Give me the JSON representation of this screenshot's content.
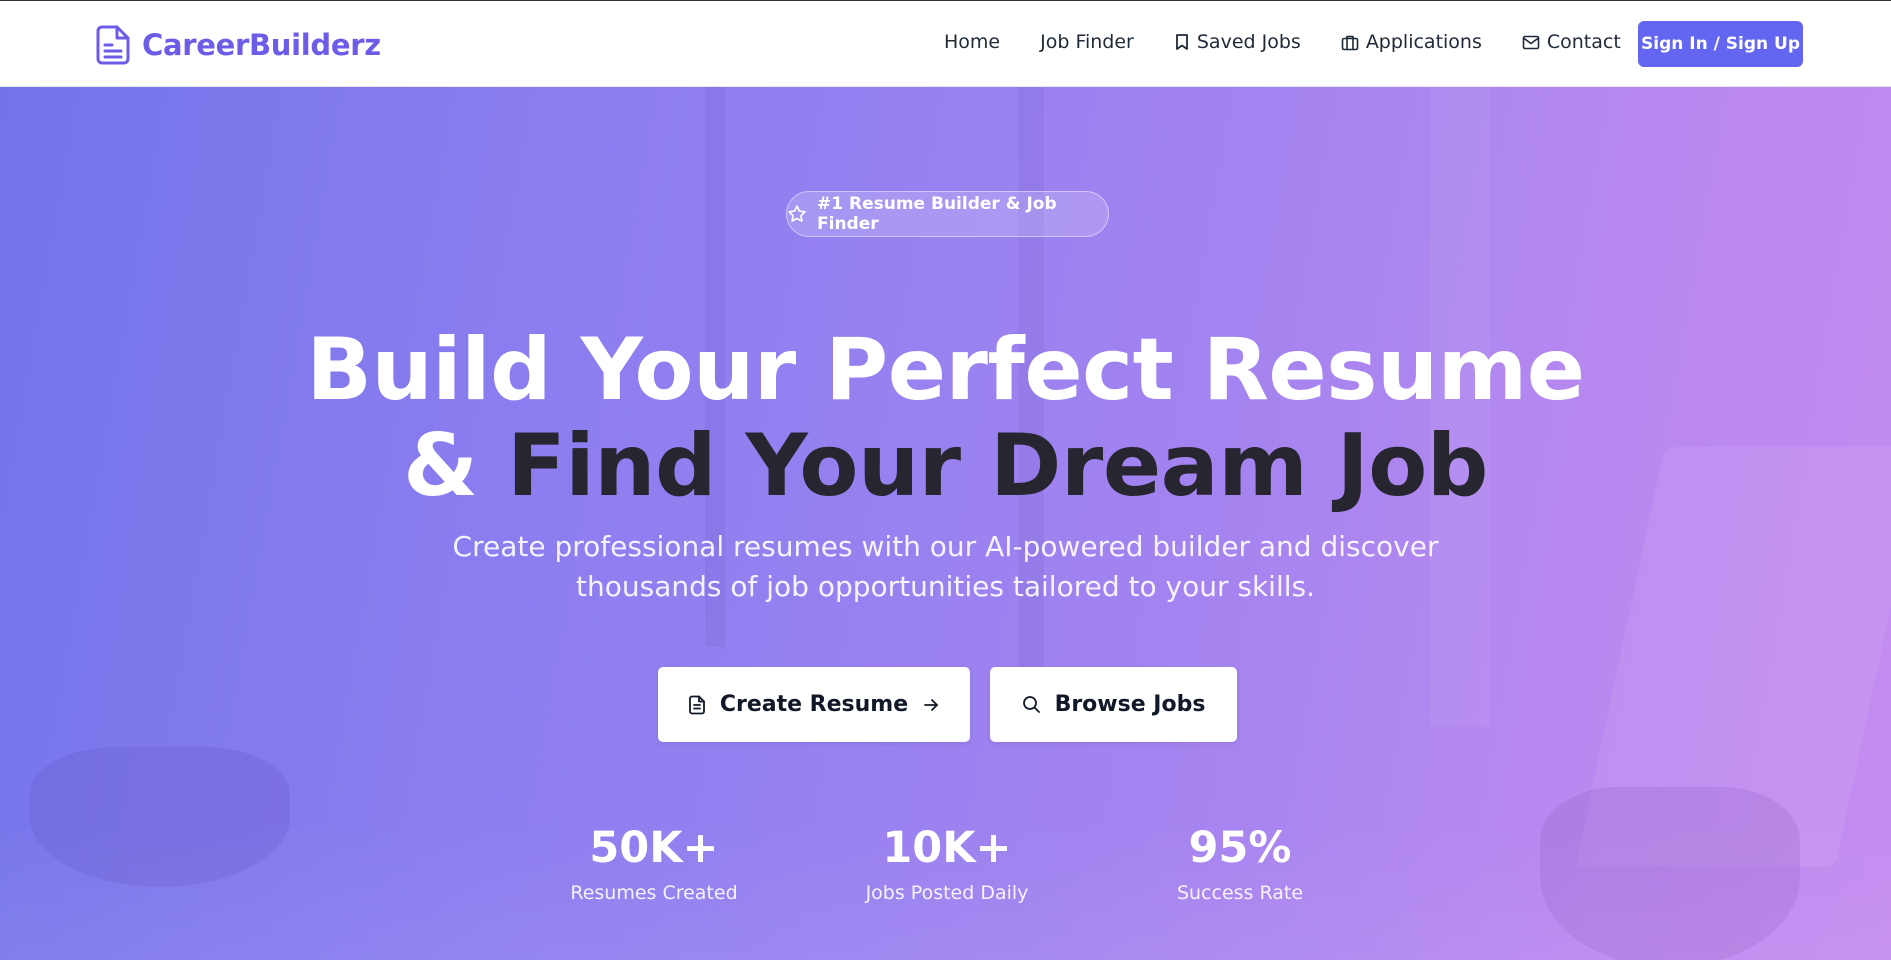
{
  "brand": {
    "name": "CareerBuilderz",
    "icon": "document-icon",
    "color": "#6d5ce8"
  },
  "nav": {
    "items": [
      {
        "label": "Home",
        "icon": null
      },
      {
        "label": "Job Finder",
        "icon": null
      },
      {
        "label": "Saved Jobs",
        "icon": "bookmark-icon"
      },
      {
        "label": "Applications",
        "icon": "briefcase-icon"
      },
      {
        "label": "Contact",
        "icon": "mail-icon"
      }
    ],
    "signin_label": "Sign In / Sign Up"
  },
  "hero": {
    "badge": "#1 Resume Builder & Job Finder",
    "title_line1": "Build Your Perfect Resume",
    "title_amp": "&",
    "title_line2": "Find Your Dream Job",
    "subtitle": "Create professional resumes with our AI-powered builder and discover thousands of job opportunities tailored to your skills.",
    "cta_create": "Create Resume",
    "cta_browse": "Browse Jobs"
  },
  "stats": [
    {
      "value": "50K+",
      "label": "Resumes Created"
    },
    {
      "value": "10K+",
      "label": "Jobs Posted Daily"
    },
    {
      "value": "95%",
      "label": "Success Rate"
    }
  ],
  "colors": {
    "accent": "#6366f1",
    "hero_gradient_start": "#7474ea",
    "hero_gradient_end": "#c58cf0",
    "dark_text": "#272530"
  }
}
